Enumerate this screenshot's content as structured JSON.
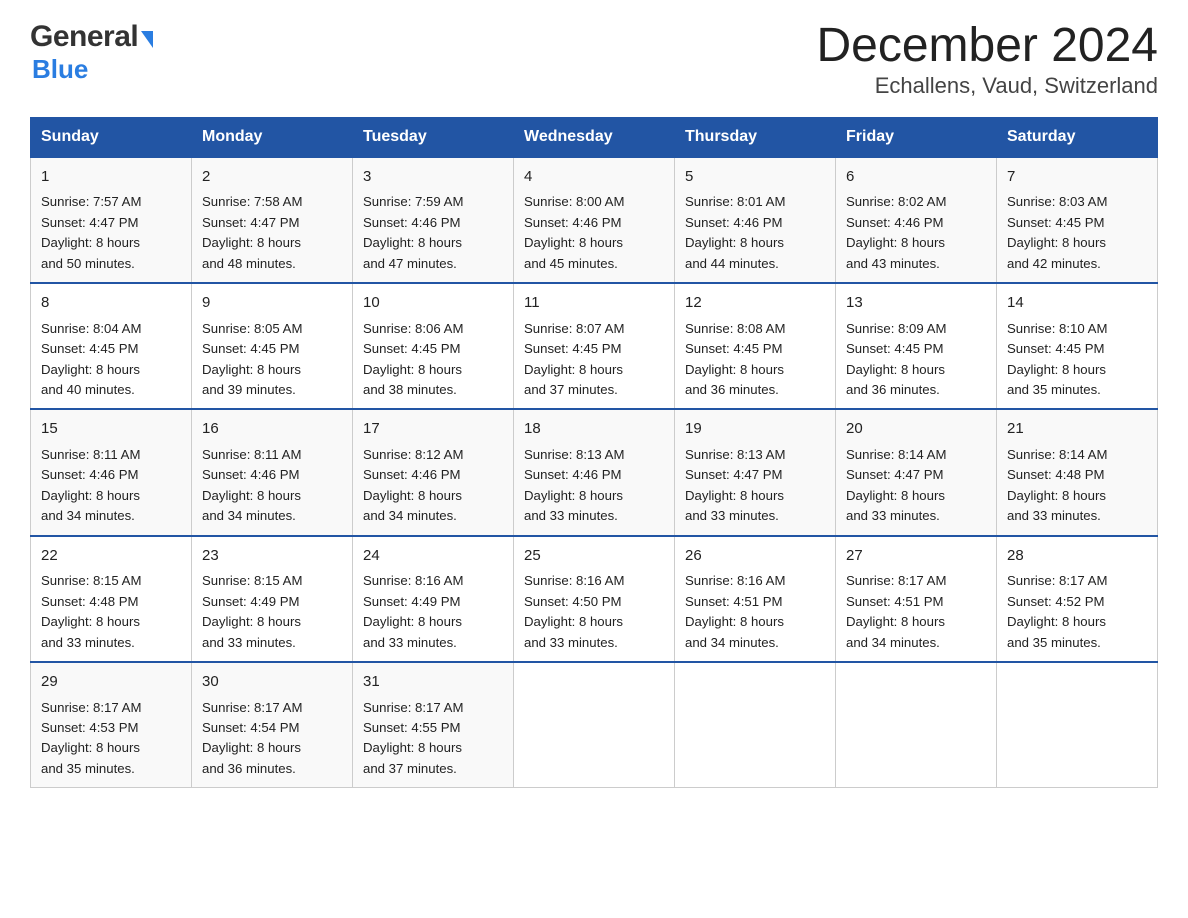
{
  "logo": {
    "general": "General",
    "blue": "Blue",
    "triangle": "▶"
  },
  "title": "December 2024",
  "subtitle": "Echallens, Vaud, Switzerland",
  "days_of_week": [
    "Sunday",
    "Monday",
    "Tuesday",
    "Wednesday",
    "Thursday",
    "Friday",
    "Saturday"
  ],
  "weeks": [
    [
      {
        "day": "1",
        "sunrise": "7:57 AM",
        "sunset": "4:47 PM",
        "daylight": "8 hours and 50 minutes."
      },
      {
        "day": "2",
        "sunrise": "7:58 AM",
        "sunset": "4:47 PM",
        "daylight": "8 hours and 48 minutes."
      },
      {
        "day": "3",
        "sunrise": "7:59 AM",
        "sunset": "4:46 PM",
        "daylight": "8 hours and 47 minutes."
      },
      {
        "day": "4",
        "sunrise": "8:00 AM",
        "sunset": "4:46 PM",
        "daylight": "8 hours and 45 minutes."
      },
      {
        "day": "5",
        "sunrise": "8:01 AM",
        "sunset": "4:46 PM",
        "daylight": "8 hours and 44 minutes."
      },
      {
        "day": "6",
        "sunrise": "8:02 AM",
        "sunset": "4:46 PM",
        "daylight": "8 hours and 43 minutes."
      },
      {
        "day": "7",
        "sunrise": "8:03 AM",
        "sunset": "4:45 PM",
        "daylight": "8 hours and 42 minutes."
      }
    ],
    [
      {
        "day": "8",
        "sunrise": "8:04 AM",
        "sunset": "4:45 PM",
        "daylight": "8 hours and 40 minutes."
      },
      {
        "day": "9",
        "sunrise": "8:05 AM",
        "sunset": "4:45 PM",
        "daylight": "8 hours and 39 minutes."
      },
      {
        "day": "10",
        "sunrise": "8:06 AM",
        "sunset": "4:45 PM",
        "daylight": "8 hours and 38 minutes."
      },
      {
        "day": "11",
        "sunrise": "8:07 AM",
        "sunset": "4:45 PM",
        "daylight": "8 hours and 37 minutes."
      },
      {
        "day": "12",
        "sunrise": "8:08 AM",
        "sunset": "4:45 PM",
        "daylight": "8 hours and 36 minutes."
      },
      {
        "day": "13",
        "sunrise": "8:09 AM",
        "sunset": "4:45 PM",
        "daylight": "8 hours and 36 minutes."
      },
      {
        "day": "14",
        "sunrise": "8:10 AM",
        "sunset": "4:45 PM",
        "daylight": "8 hours and 35 minutes."
      }
    ],
    [
      {
        "day": "15",
        "sunrise": "8:11 AM",
        "sunset": "4:46 PM",
        "daylight": "8 hours and 34 minutes."
      },
      {
        "day": "16",
        "sunrise": "8:11 AM",
        "sunset": "4:46 PM",
        "daylight": "8 hours and 34 minutes."
      },
      {
        "day": "17",
        "sunrise": "8:12 AM",
        "sunset": "4:46 PM",
        "daylight": "8 hours and 34 minutes."
      },
      {
        "day": "18",
        "sunrise": "8:13 AM",
        "sunset": "4:46 PM",
        "daylight": "8 hours and 33 minutes."
      },
      {
        "day": "19",
        "sunrise": "8:13 AM",
        "sunset": "4:47 PM",
        "daylight": "8 hours and 33 minutes."
      },
      {
        "day": "20",
        "sunrise": "8:14 AM",
        "sunset": "4:47 PM",
        "daylight": "8 hours and 33 minutes."
      },
      {
        "day": "21",
        "sunrise": "8:14 AM",
        "sunset": "4:48 PM",
        "daylight": "8 hours and 33 minutes."
      }
    ],
    [
      {
        "day": "22",
        "sunrise": "8:15 AM",
        "sunset": "4:48 PM",
        "daylight": "8 hours and 33 minutes."
      },
      {
        "day": "23",
        "sunrise": "8:15 AM",
        "sunset": "4:49 PM",
        "daylight": "8 hours and 33 minutes."
      },
      {
        "day": "24",
        "sunrise": "8:16 AM",
        "sunset": "4:49 PM",
        "daylight": "8 hours and 33 minutes."
      },
      {
        "day": "25",
        "sunrise": "8:16 AM",
        "sunset": "4:50 PM",
        "daylight": "8 hours and 33 minutes."
      },
      {
        "day": "26",
        "sunrise": "8:16 AM",
        "sunset": "4:51 PM",
        "daylight": "8 hours and 34 minutes."
      },
      {
        "day": "27",
        "sunrise": "8:17 AM",
        "sunset": "4:51 PM",
        "daylight": "8 hours and 34 minutes."
      },
      {
        "day": "28",
        "sunrise": "8:17 AM",
        "sunset": "4:52 PM",
        "daylight": "8 hours and 35 minutes."
      }
    ],
    [
      {
        "day": "29",
        "sunrise": "8:17 AM",
        "sunset": "4:53 PM",
        "daylight": "8 hours and 35 minutes."
      },
      {
        "day": "30",
        "sunrise": "8:17 AM",
        "sunset": "4:54 PM",
        "daylight": "8 hours and 36 minutes."
      },
      {
        "day": "31",
        "sunrise": "8:17 AM",
        "sunset": "4:55 PM",
        "daylight": "8 hours and 37 minutes."
      },
      null,
      null,
      null,
      null
    ]
  ],
  "labels": {
    "sunrise": "Sunrise:",
    "sunset": "Sunset:",
    "daylight": "Daylight:"
  }
}
